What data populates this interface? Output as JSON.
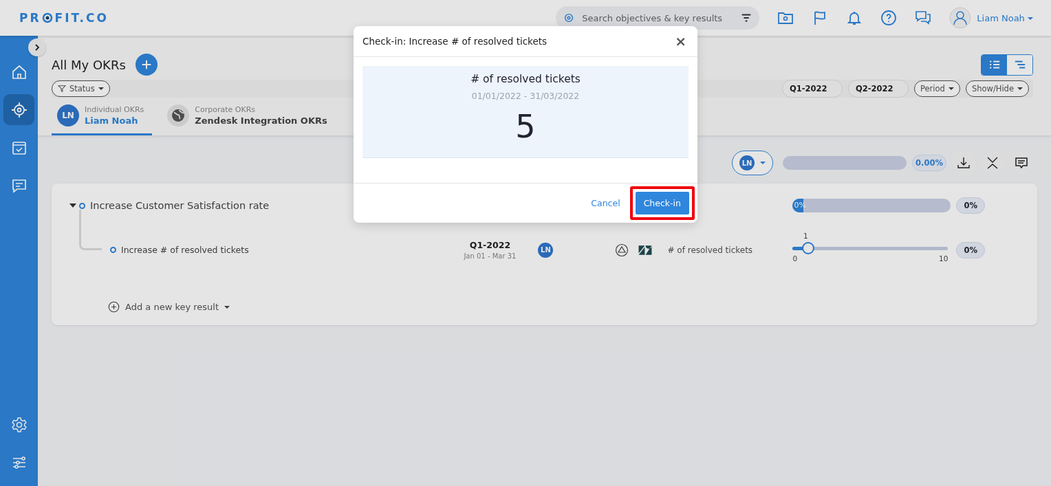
{
  "header": {
    "logo_start": "PR",
    "logo_end": "FIT.CO",
    "search": {
      "placeholder": "Search objectives & key results"
    },
    "user": "Liam Noah"
  },
  "sidebar": {
    "items": [
      {
        "kind": "home",
        "selected": false
      },
      {
        "kind": "target",
        "selected": true
      },
      {
        "kind": "calendar",
        "selected": false
      },
      {
        "kind": "chat",
        "selected": false
      }
    ],
    "bottom": [
      {
        "kind": "settings",
        "selected": false
      },
      {
        "kind": "sliders",
        "selected": false
      }
    ]
  },
  "page": {
    "title": "All My OKRs",
    "status_filter": "Status",
    "periods": [
      "Q1-2022",
      "Q2-2022"
    ],
    "dropdowns": [
      "Period",
      "Show/Hide"
    ],
    "views": [
      {
        "kind": "list",
        "selected": true
      },
      {
        "kind": "tree",
        "selected": false
      }
    ],
    "tabs": [
      {
        "caption": "Individual OKRs",
        "label": "Liam Noah",
        "avatar": "LN",
        "selected": true
      },
      {
        "caption": "Corporate OKRs",
        "label": "Zendesk Integration OKRs",
        "selected": false
      }
    ]
  },
  "toolbar": {
    "owner": "LN",
    "level": 0,
    "reading": "0.00%"
  },
  "objective": {
    "title": "Increase Customer Satisfaction rate",
    "expanded": true,
    "level": 0,
    "bar_label": "0%",
    "reading": "0%",
    "key_results": [
      {
        "title": "Increase # of resolved tickets",
        "period": "Q1-2022",
        "dates": "Jan 01 - Mar 31",
        "owner": "LN",
        "metric": "# of resolved tickets",
        "min": "0",
        "max": "10",
        "value": "1",
        "level": 0.1,
        "reading": "0%"
      }
    ],
    "add_label": "Add a new key result"
  },
  "modal": {
    "title": "Check-in: Increase # of resolved tickets",
    "close": "×",
    "metric": "# of resolved tickets",
    "dates": "01/01/2022 - 31/03/2022",
    "value": "5",
    "cancel": "Cancel",
    "submit": "Check-in",
    "highlighted": true
  }
}
